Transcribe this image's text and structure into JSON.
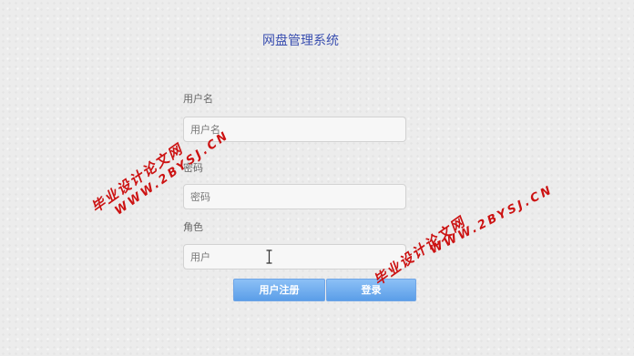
{
  "app": {
    "title": "网盘管理系统"
  },
  "form": {
    "username": {
      "label": "用户名",
      "placeholder": "用户名",
      "value": ""
    },
    "password": {
      "label": "密码",
      "placeholder": "密码",
      "value": ""
    },
    "role": {
      "label": "角色",
      "placeholder": "用户",
      "value": ""
    }
  },
  "buttons": {
    "register": "用户注册",
    "login": "登录"
  },
  "watermarks": [
    {
      "cn": "毕业设计论文网",
      "url": "WWW.2BYSJ.CN"
    },
    {
      "cn": "毕业设计论文网",
      "url": "WWW.2BYSJ.CN"
    }
  ],
  "colors": {
    "title": "#3a4fb0",
    "button": "#6aa8ee",
    "watermark": "#cc1212"
  }
}
